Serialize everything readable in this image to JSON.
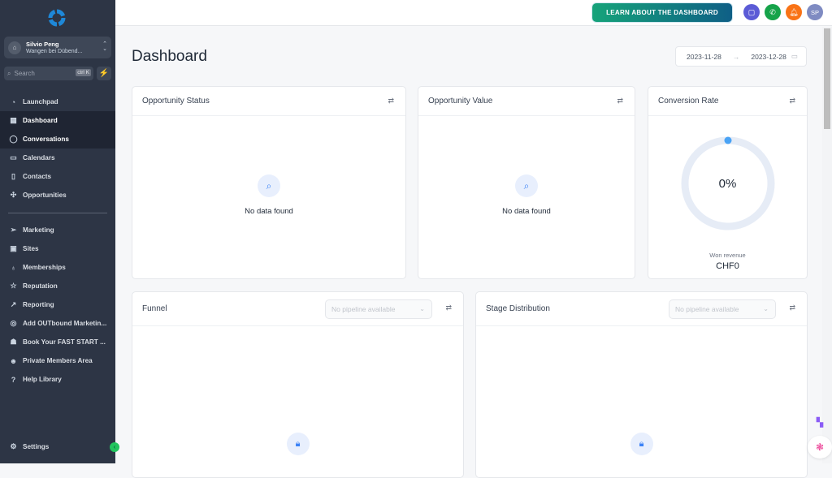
{
  "account": {
    "name": "Silvio Peng",
    "location": "Wangen bei Dübend..."
  },
  "search": {
    "placeholder": "Search",
    "shortcut": "ctrl K"
  },
  "sidebar": {
    "items": [
      {
        "label": "Launchpad",
        "icon": "rocket-icon"
      },
      {
        "label": "Dashboard",
        "icon": "grid-icon",
        "active": true
      },
      {
        "label": "Conversations",
        "icon": "chat-bubble-icon"
      },
      {
        "label": "Calendars",
        "icon": "calendar-icon"
      },
      {
        "label": "Contacts",
        "icon": "address-book-icon"
      },
      {
        "label": "Opportunities",
        "icon": "opportunities-icon"
      }
    ],
    "items2": [
      {
        "label": "Marketing",
        "icon": "paper-plane-icon"
      },
      {
        "label": "Sites",
        "icon": "browser-window-icon"
      },
      {
        "label": "Memberships",
        "icon": "award-icon"
      },
      {
        "label": "Reputation",
        "icon": "star-icon"
      },
      {
        "label": "Reporting",
        "icon": "trend-up-icon"
      },
      {
        "label": "Add OUTbound Marketin...",
        "icon": "viber-icon"
      },
      {
        "label": "Book Your FAST START ...",
        "icon": "users-group-icon"
      },
      {
        "label": "Private Members Area",
        "icon": "user-group-icon"
      },
      {
        "label": "Help Library",
        "icon": "question-circle-icon"
      }
    ],
    "settings": "Settings"
  },
  "topbar": {
    "learn_button": "LEARN ABOUT THE DASHBOARD",
    "avatar_initials": "SP",
    "colors": {
      "chat": "#5b5bd6",
      "phone": "#16a34a",
      "bell": "#f97316",
      "avatar": "#7f8bc2"
    }
  },
  "page": {
    "title": "Dashboard",
    "date_start": "2023-11-28",
    "date_arrow": "→",
    "date_end": "2023-12-28"
  },
  "cards": {
    "opportunity_status": {
      "title": "Opportunity Status",
      "empty": "No data found"
    },
    "opportunity_value": {
      "title": "Opportunity Value",
      "empty": "No data found"
    },
    "conversion_rate": {
      "title": "Conversion Rate",
      "value": "0%",
      "percent": 0,
      "won_label": "Won revenue",
      "won_value": "CHF0"
    },
    "funnel": {
      "title": "Funnel",
      "select": "No pipeline available"
    },
    "stage_distribution": {
      "title": "Stage Distribution",
      "select": "No pipeline available"
    }
  }
}
